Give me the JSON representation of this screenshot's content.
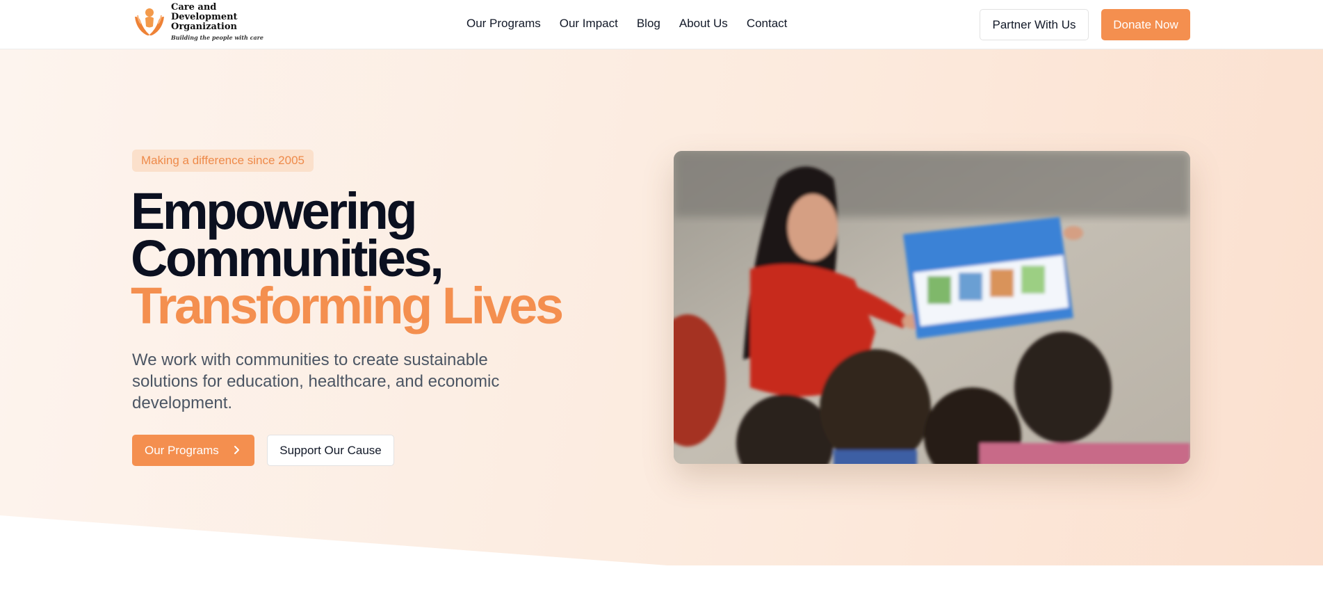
{
  "header": {
    "logo": {
      "name_line1": "Care and Development",
      "name_line2": "Organization",
      "tagline": "Building the people with care",
      "icon": "hands-holding-person-icon"
    },
    "nav": [
      {
        "label": "Our Programs"
      },
      {
        "label": "Our Impact"
      },
      {
        "label": "Blog"
      },
      {
        "label": "About Us"
      },
      {
        "label": "Contact"
      }
    ],
    "partner_label": "Partner With Us",
    "donate_label": "Donate Now"
  },
  "hero": {
    "badge": "Making a difference since 2005",
    "headline_line1": "Empowering",
    "headline_line2": "Communities,",
    "headline_accent": "Transforming Lives",
    "subtext": "We work with communities to create sustainable solutions for education, healthcare, and economic development.",
    "primary_button": "Our Programs",
    "primary_button_icon": "chevron-right-icon",
    "secondary_button": "Support Our Cause",
    "image_alt": "Teacher showing an illustrated flip chart to a group of children"
  },
  "colors": {
    "accent": "#f48f4f",
    "badge_bg": "#fbe0cb",
    "heading": "#0b1020",
    "body_text": "#4b5563",
    "hero_bg": "#fceadd"
  }
}
